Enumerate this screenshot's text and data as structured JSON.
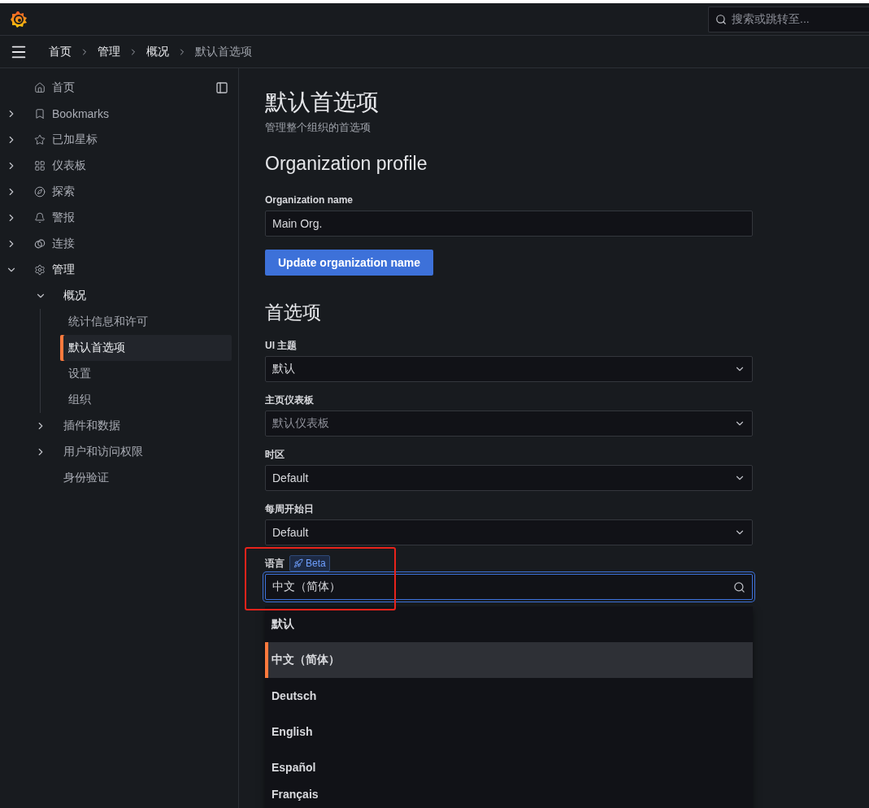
{
  "topbar": {
    "search": {
      "placeholder": "搜索或跳转至..."
    }
  },
  "breadcrumbs": [
    {
      "label": "首页",
      "current": false
    },
    {
      "label": "管理",
      "current": false
    },
    {
      "label": "概况",
      "current": false
    },
    {
      "label": "默认首选项",
      "current": true
    }
  ],
  "sidebar": {
    "items": [
      {
        "label": "首页",
        "kind": "link",
        "selected": false
      },
      {
        "label": "Bookmarks",
        "kind": "group",
        "expanded": false,
        "selected": false
      },
      {
        "label": "已加星标",
        "kind": "group",
        "expanded": false,
        "selected": false
      },
      {
        "label": "仪表板",
        "kind": "group",
        "expanded": false,
        "selected": false
      },
      {
        "label": "探索",
        "kind": "group",
        "expanded": false,
        "selected": false
      },
      {
        "label": "警报",
        "kind": "group",
        "expanded": false,
        "selected": false
      },
      {
        "label": "连接",
        "kind": "group",
        "expanded": false,
        "selected": false
      },
      {
        "label": "管理",
        "kind": "group",
        "expanded": true,
        "selected": false,
        "children": [
          {
            "label": "概况",
            "kind": "group",
            "expanded": true,
            "selected": false,
            "children": [
              {
                "label": "统计信息和许可",
                "selected": false
              },
              {
                "label": "默认首选项",
                "selected": true
              },
              {
                "label": "设置",
                "selected": false
              },
              {
                "label": "组织",
                "selected": false
              }
            ]
          },
          {
            "label": "插件和数据",
            "kind": "group",
            "expanded": false,
            "selected": false
          },
          {
            "label": "用户和访问权限",
            "kind": "group",
            "expanded": false,
            "selected": false
          },
          {
            "label": "身份验证",
            "kind": "link",
            "selected": false
          }
        ]
      }
    ]
  },
  "page": {
    "title": "默认首选项",
    "subtitle": "管理整个组织的首选项",
    "profile": {
      "heading": "Organization profile",
      "field_label": "Organization name",
      "value": "Main Org.",
      "button": "Update organization name"
    },
    "preferences": {
      "heading": "首选项",
      "selects": [
        {
          "label": "UI 主题",
          "value": "默认"
        },
        {
          "label": "主页仪表板",
          "placeholder": "默认仪表板"
        },
        {
          "label": "时区",
          "value": "Default"
        },
        {
          "label": "每周开始日",
          "value": "Default"
        }
      ],
      "language": {
        "label": "语言",
        "badge": "Beta",
        "value": "中文（简体）",
        "focused": true,
        "options": [
          {
            "label": "默认",
            "selected": false
          },
          {
            "label": "中文（简体）",
            "selected": true
          },
          {
            "label": "Deutsch",
            "selected": false
          },
          {
            "label": "English",
            "selected": false
          },
          {
            "label": "Español",
            "selected": false
          },
          {
            "label": "Français",
            "selected": false
          }
        ]
      }
    }
  }
}
